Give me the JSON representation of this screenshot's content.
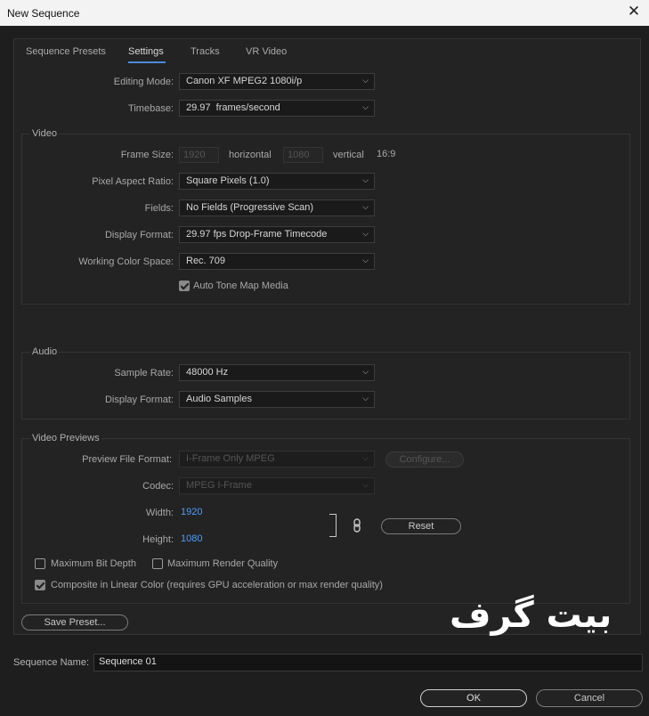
{
  "window": {
    "title": "New Sequence",
    "close": "✕"
  },
  "tabs": [
    "Sequence Presets",
    "Settings",
    "Tracks",
    "VR Video"
  ],
  "general": {
    "editing_mode_label": "Editing Mode:",
    "editing_mode_value": "Canon XF MPEG2 1080i/p",
    "timebase_label": "Timebase:",
    "timebase_value": "29.97  frames/second"
  },
  "video": {
    "title": "Video",
    "frame_size_label": "Frame Size:",
    "frame_width": "1920",
    "horizontal_label": "horizontal",
    "frame_height": "1080",
    "vertical_label": "vertical",
    "aspect": "16:9",
    "par_label": "Pixel Aspect Ratio:",
    "par_value": "Square Pixels (1.0)",
    "fields_label": "Fields:",
    "fields_value": "No Fields (Progressive Scan)",
    "display_format_label": "Display Format:",
    "display_format_value": "29.97 fps Drop-Frame Timecode",
    "color_space_label": "Working Color Space:",
    "color_space_value": "Rec. 709",
    "auto_tone_label": "Auto Tone Map Media",
    "auto_tone_checked": true
  },
  "audio": {
    "title": "Audio",
    "sample_rate_label": "Sample Rate:",
    "sample_rate_value": "48000 Hz",
    "display_format_label": "Display Format:",
    "display_format_value": "Audio Samples"
  },
  "previews": {
    "title": "Video Previews",
    "file_format_label": "Preview File Format:",
    "file_format_value": "I-Frame Only MPEG",
    "configure_label": "Configure...",
    "codec_label": "Codec:",
    "codec_value": "MPEG I-Frame",
    "width_label": "Width:",
    "width_value": "1920",
    "height_label": "Height:",
    "height_value": "1080",
    "reset_label": "Reset",
    "max_bit_depth_label": "Maximum Bit Depth",
    "max_render_quality_label": "Maximum Render Quality",
    "composite_label": "Composite in Linear Color (requires GPU acceleration or max render quality)",
    "composite_checked": true
  },
  "save_preset_label": "Save Preset...",
  "sequence_name_label": "Sequence Name:",
  "sequence_name_value": "Sequence 01",
  "ok_label": "OK",
  "cancel_label": "Cancel",
  "watermark_text": "بیت گرف",
  "colors": {
    "accent": "#4b8bd8",
    "link_blue": "#4a9eff",
    "background": "#1e1e1e"
  }
}
